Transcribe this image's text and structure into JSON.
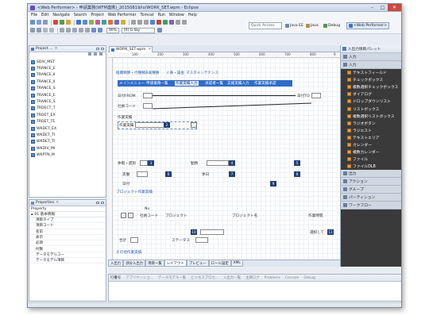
{
  "window": {
    "title": "<Web Performer> - 申請業務(WFM連携)_20150819/io/WORK_SET.wpm - Eclipse",
    "controls": [
      "–",
      "□",
      "✕"
    ]
  },
  "menu": [
    "File",
    "Edit",
    "Navigate",
    "Search",
    "Project",
    "Web Performer",
    "Tomcat",
    "Run",
    "Window",
    "Help"
  ],
  "toolbar": {
    "zoom": "90%",
    "skin": "[R] G-Sky",
    "quick_access_placeholder": "Quick Access",
    "perspectives": [
      "Java EE",
      "Java",
      "Debug",
      "<Web Performer>"
    ]
  },
  "project_explorer": {
    "tab_label": "Project ...",
    "items": [
      "SDIV_MST",
      "TRANCE_E",
      "TRANCE_II",
      "TRANCE_II",
      "TRANCE_S",
      "TRANCE_E",
      "TRANCE_S",
      "TRDECT_T",
      "TRDET_EX",
      "TRDET_TE",
      "WKDET_EX",
      "WKDET_TI",
      "WKDET_TI",
      "WKDIV_MI",
      "WKPTN_M"
    ]
  },
  "properties": {
    "tab_label": "Properties",
    "header": "Property",
    "group": "01 基本情報",
    "rows": [
      "項目タイプ",
      "項目コード",
      "名前",
      "表示",
      "必須",
      "桁数",
      "データモデルコー",
      "データモデル項目"
    ]
  },
  "editor": {
    "tab_label": "WORK_SET.wpm",
    "ruler_ticks": [
      "100",
      "200",
      "300",
      "400",
      "500",
      "600",
      "700",
      "800",
      "9"
    ],
    "canvas": {
      "header_links": [
        "経費精算・行種類",
        "決裁種類",
        "人事・賃金",
        "マスタメンテナンス"
      ],
      "nav_items": [
        "メインメニュー",
        "申請業務一覧",
        "作業実績入力",
        "承認者一覧",
        "支援実績入力",
        "作業実績承認"
      ],
      "labels": {
        "date_from": "日付FROM",
        "date_to": "日付TO",
        "employee_code": "社員コード",
        "work_result": "作業実績",
        "cat_row1": "休暇・遅刻",
        "cat_row2": "実働",
        "cat_row3": "日付",
        "overtime": "勤務",
        "holiday": "休日",
        "project_link": "プロジェクト作業実績",
        "no": "No",
        "employee_code2": "社員コード",
        "project": "プロジェクト",
        "project_name": "プロジェクト名",
        "work_time": "作業時間",
        "status": "ステータス",
        "choice": "選択して",
        "total": "合計",
        "other": "その他作業実績"
      },
      "badges": [
        "2",
        "3",
        "4",
        "5",
        "6",
        "7",
        "8",
        "9",
        "10",
        "11",
        "12",
        "13",
        "14"
      ]
    },
    "bottom_tabs": [
      "入出力",
      "部分入出力",
      "項目一覧",
      "レイアウト",
      "プレビュー",
      "ロール設定",
      "XML"
    ],
    "active_bottom_tab": "レイアウト"
  },
  "palette": {
    "title": "入出力項目パレット",
    "categories_top": [
      "入力",
      "入力"
    ],
    "items": [
      "テキストフィールド",
      "チェックボックス",
      "複数選択チェックボックス",
      "ダイアログ",
      "ドロップダウンリスト",
      "リストボックス",
      "複数選択リストボックス",
      "ラジオボタン",
      "ラジエスト",
      "テキストエリア",
      "カレンダー",
      "複数カレンダー",
      "ファイル",
      "ファイルDLB"
    ],
    "categories_bottom": [
      "出力",
      "アクション",
      "グループ",
      "パーティション",
      "ワークフロー"
    ]
  },
  "bottom_panel": {
    "tabs": [
      "行番号",
      "アプリケーショ...",
      "データモデル一覧",
      "ビジネスプロセ...",
      "入出力一覧",
      "主題ログ",
      "Problems",
      "Console",
      "Debug"
    ]
  }
}
